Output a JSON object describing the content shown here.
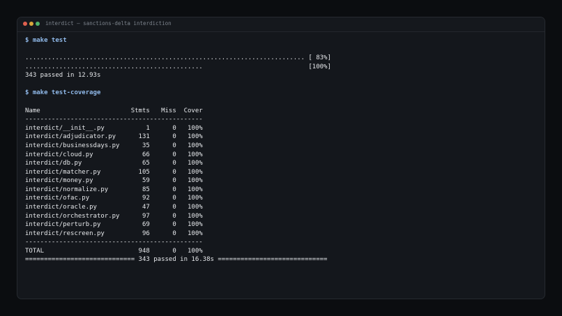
{
  "window": {
    "title": "interdict — sanctions-delta interdiction"
  },
  "terminal": {
    "lines": [
      {
        "type": "cmd",
        "prompt": "$",
        "text": "make test"
      },
      {
        "type": "blank",
        "text": ""
      },
      {
        "type": "out",
        "text": ".......................................................................... [ 83%]"
      },
      {
        "type": "out",
        "text": "...............................................                            [100%]"
      },
      {
        "type": "out",
        "text": "343 passed in 12.93s"
      },
      {
        "type": "blank",
        "text": ""
      },
      {
        "type": "cmd",
        "prompt": "$",
        "text": "make test-coverage"
      },
      {
        "type": "blank",
        "text": ""
      },
      {
        "type": "out",
        "text": "Name                        Stmts   Miss  Cover"
      },
      {
        "type": "out",
        "text": "-----------------------------------------------"
      },
      {
        "type": "out",
        "text": "interdict/__init__.py           1      0   100%"
      },
      {
        "type": "out",
        "text": "interdict/adjudicator.py      131      0   100%"
      },
      {
        "type": "out",
        "text": "interdict/businessdays.py      35      0   100%"
      },
      {
        "type": "out",
        "text": "interdict/cloud.py             66      0   100%"
      },
      {
        "type": "out",
        "text": "interdict/db.py                65      0   100%"
      },
      {
        "type": "out",
        "text": "interdict/matcher.py          105      0   100%"
      },
      {
        "type": "out",
        "text": "interdict/money.py             59      0   100%"
      },
      {
        "type": "out",
        "text": "interdict/normalize.py         85      0   100%"
      },
      {
        "type": "out",
        "text": "interdict/ofac.py              92      0   100%"
      },
      {
        "type": "out",
        "text": "interdict/oracle.py            47      0   100%"
      },
      {
        "type": "out",
        "text": "interdict/orchestrator.py      97      0   100%"
      },
      {
        "type": "out",
        "text": "interdict/perturb.py           69      0   100%"
      },
      {
        "type": "out",
        "text": "interdict/rescreen.py          96      0   100%"
      },
      {
        "type": "out",
        "text": "-----------------------------------------------"
      },
      {
        "type": "out",
        "text": "TOTAL                         948      0   100%"
      },
      {
        "type": "out",
        "text": "============================= 343 passed in 16.38s ============================="
      }
    ]
  }
}
